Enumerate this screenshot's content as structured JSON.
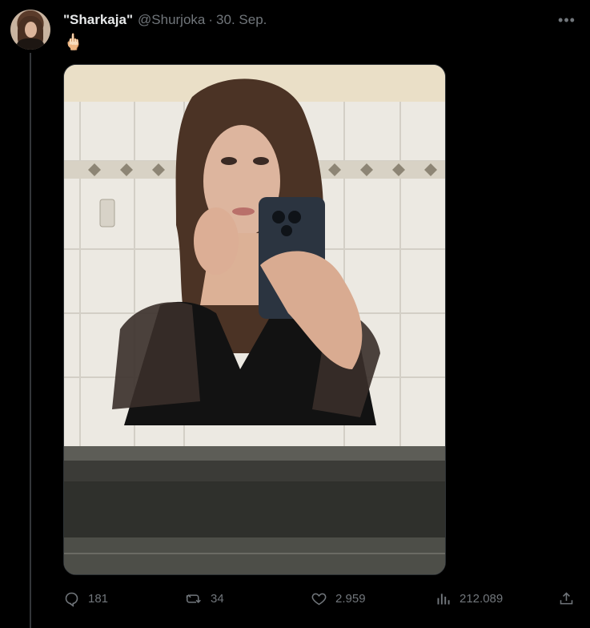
{
  "tweet": {
    "display_name": "\"Sharkaja\"",
    "handle": "@Shurjoka",
    "separator": "·",
    "date": "30. Sep.",
    "text": "🖕🏻",
    "more_icon": "ellipsis-icon",
    "media": {
      "type": "photo",
      "description_icon": "photo"
    }
  },
  "actions": {
    "reply": {
      "icon": "reply-icon",
      "count": "181"
    },
    "retweet": {
      "icon": "retweet-icon",
      "count": "34"
    },
    "like": {
      "icon": "heart-icon",
      "count": "2.959"
    },
    "views": {
      "icon": "views-icon",
      "count": "212.089"
    },
    "share": {
      "icon": "share-icon"
    }
  },
  "colors": {
    "background": "#000000",
    "text_primary": "#e7e9ea",
    "text_secondary": "#71767b",
    "border": "#2f3336"
  }
}
